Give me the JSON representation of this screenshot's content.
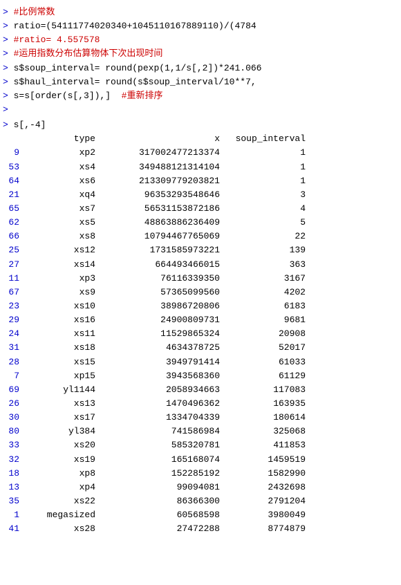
{
  "console": {
    "lines": [
      {
        "type": "comment",
        "text": "> #比例常数"
      },
      {
        "type": "code",
        "text": "> ratio=(54111774020340+1045110167889110)/(4784",
        "prompt": true
      },
      {
        "type": "comment",
        "text": "> #ratio= 4.557578"
      },
      {
        "type": "comment",
        "text": "> #运用指数分布估算物体下次出现时间"
      },
      {
        "type": "code",
        "text": "> s$soup_interval= round(pexp(1,1/s[,2])*241.066",
        "prompt": true
      },
      {
        "type": "code",
        "text": "> s$haul_interval= round(s$soup_interval/10**7,",
        "prompt": true
      },
      {
        "type": "code",
        "text": "> s=s[order(s[,3]),]  #重新排序",
        "prompt": true
      },
      {
        "type": "code",
        "text": ">",
        "prompt": true
      }
    ],
    "table_command": "> s[,-4]",
    "table_headers": {
      "idx": "",
      "type": "type",
      "x": "x",
      "soup_interval": "soup_interval"
    },
    "table_rows": [
      {
        "idx": "9",
        "type": "xp2",
        "x": "317002477213374",
        "soup": "1"
      },
      {
        "idx": "53",
        "type": "xs4",
        "x": "349488121314104",
        "soup": "1"
      },
      {
        "idx": "64",
        "type": "xs6",
        "x": "213309779203821",
        "soup": "1"
      },
      {
        "idx": "21",
        "type": "xq4",
        "x": "96353293548646",
        "soup": "3"
      },
      {
        "idx": "65",
        "type": "xs7",
        "x": "56531153872186",
        "soup": "4"
      },
      {
        "idx": "62",
        "type": "xs5",
        "x": "48863886236409",
        "soup": "5"
      },
      {
        "idx": "66",
        "type": "xs8",
        "x": "10794467765069",
        "soup": "22"
      },
      {
        "idx": "25",
        "type": "xs12",
        "x": "1731585973221",
        "soup": "139"
      },
      {
        "idx": "27",
        "type": "xs14",
        "x": "664493466015",
        "soup": "363"
      },
      {
        "idx": "11",
        "type": "xp3",
        "x": "76116339350",
        "soup": "3167"
      },
      {
        "idx": "67",
        "type": "xs9",
        "x": "57365099560",
        "soup": "4202"
      },
      {
        "idx": "23",
        "type": "xs10",
        "x": "38986720806",
        "soup": "6183"
      },
      {
        "idx": "29",
        "type": "xs16",
        "x": "24900809731",
        "soup": "9681"
      },
      {
        "idx": "24",
        "type": "xs11",
        "x": "11529865324",
        "soup": "20908"
      },
      {
        "idx": "31",
        "type": "xs18",
        "x": "4634378725",
        "soup": "52017"
      },
      {
        "idx": "28",
        "type": "xs15",
        "x": "3949791414",
        "soup": "61033"
      },
      {
        "idx": "7",
        "type": "xp15",
        "x": "3943568360",
        "soup": "61129"
      },
      {
        "idx": "69",
        "type": "yl1144",
        "x": "2058934663",
        "soup": "117083"
      },
      {
        "idx": "26",
        "type": "xs13",
        "x": "1470496362",
        "soup": "163935"
      },
      {
        "idx": "30",
        "type": "xs17",
        "x": "1334704339",
        "soup": "180614"
      },
      {
        "idx": "80",
        "type": "yl384",
        "x": "741586984",
        "soup": "325068"
      },
      {
        "idx": "33",
        "type": "xs20",
        "x": "585320781",
        "soup": "411853"
      },
      {
        "idx": "32",
        "type": "xs19",
        "x": "165168074",
        "soup": "1459519"
      },
      {
        "idx": "18",
        "type": "xp8",
        "x": "152285192",
        "soup": "1582990"
      },
      {
        "idx": "13",
        "type": "xp4",
        "x": "99094081",
        "soup": "2432698"
      },
      {
        "idx": "35",
        "type": "xs22",
        "x": "86366300",
        "soup": "2791204"
      },
      {
        "idx": "1",
        "type": "megasized",
        "x": "60568598",
        "soup": "3980049"
      },
      {
        "idx": "41",
        "type": "xs28",
        "x": "27472288",
        "soup": "8774879"
      }
    ]
  }
}
